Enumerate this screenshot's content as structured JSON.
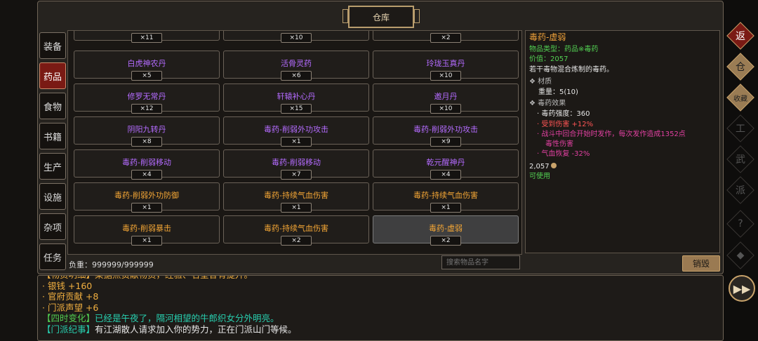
{
  "window_title": "仓库",
  "tabs": [
    "装备",
    "药品",
    "食物",
    "书籍",
    "生产",
    "设施",
    "杂项",
    "任务"
  ],
  "active_tab": "药品",
  "top_counts": [
    "×11",
    "×10",
    "×2"
  ],
  "items": [
    {
      "name": "白虎神农丹",
      "count": "×5",
      "color": "purple"
    },
    {
      "name": "活骨灵药",
      "count": "×6",
      "color": "purple"
    },
    {
      "name": "玲珑玉真丹",
      "count": "×10",
      "color": "purple"
    },
    {
      "name": "修罗无常丹",
      "count": "×12",
      "color": "purple"
    },
    {
      "name": "轩辕补心丹",
      "count": "×15",
      "color": "purple"
    },
    {
      "name": "邀月丹",
      "count": "×10",
      "color": "purple"
    },
    {
      "name": "阴阳九转丹",
      "count": "×8",
      "color": "purple"
    },
    {
      "name": "毒药-削弱外功攻击",
      "count": "×1",
      "color": "purple"
    },
    {
      "name": "毒药-削弱外功攻击",
      "count": "×9",
      "color": "purple"
    },
    {
      "name": "毒药-削弱移动",
      "count": "×4",
      "color": "purple"
    },
    {
      "name": "毒药-削弱移动",
      "count": "×7",
      "color": "purple"
    },
    {
      "name": "乾元醒神丹",
      "count": "×4",
      "color": "purple"
    },
    {
      "name": "毒药-削弱外功防御",
      "count": "×1",
      "color": "orange"
    },
    {
      "name": "毒药-持续气血伤害",
      "count": "×1",
      "color": "orange"
    },
    {
      "name": "毒药-持续气血伤害",
      "count": "×1",
      "color": "orange"
    },
    {
      "name": "毒药-削弱暴击",
      "count": "×1",
      "color": "orange"
    },
    {
      "name": "毒药-持续气血伤害",
      "count": "×2",
      "color": "orange"
    },
    {
      "name": "毒药-虚弱",
      "count": "×2",
      "color": "orange",
      "selected": true
    }
  ],
  "weight_text": "负重：999999/999999",
  "search_placeholder": "搜索物品名字",
  "destroy_label": "销毁",
  "detail": {
    "name": "毒药-虚弱",
    "type": "物品类型：药品※毒药",
    "price": "价值：2057",
    "desc": "若干毒物混合炼制的毒药。",
    "material_header": "❖ 材质",
    "weight": "重量：5(10)",
    "effect_header": "❖ 毒药效果",
    "strength": "· 毒药强度：360",
    "dmg_taken": "· 受到伤害 +12%",
    "dot_1": "· 战斗中回合开始时发作，每次发作造成1352点",
    "dot_2": "毒性伤害",
    "hp_regen": "· 气血恢复 -32%",
    "money": "2,057",
    "usable": "可使用"
  },
  "log": [
    {
      "segments": [
        {
          "t": "【物资明细】某据点贡献物资，经验、名望各有提升。",
          "c": "lorange"
        }
      ]
    },
    {
      "segments": [
        {
          "t": "            · 银钱 +160",
          "c": "lorange"
        }
      ]
    },
    {
      "segments": [
        {
          "t": "            · 官府贡献 +8",
          "c": "lorange"
        }
      ]
    },
    {
      "segments": [
        {
          "t": "            · 门派声望 +6",
          "c": "lorange"
        }
      ]
    },
    {
      "segments": [
        {
          "t": "【四时变化】",
          "c": "green"
        },
        {
          "t": "已经是午夜了，隔河相望的牛郎织女分外明亮。",
          "c": "cyan"
        }
      ]
    },
    {
      "segments": [
        {
          "t": "【门派纪事】",
          "c": "cyan"
        },
        {
          "t": "有江湖散人请求加入你的势力，正在门派山门等候。",
          "c": "white"
        }
      ]
    }
  ],
  "side_buttons": [
    "返",
    "仓",
    "收藏",
    "工",
    "武",
    "派",
    "?",
    "◆"
  ]
}
